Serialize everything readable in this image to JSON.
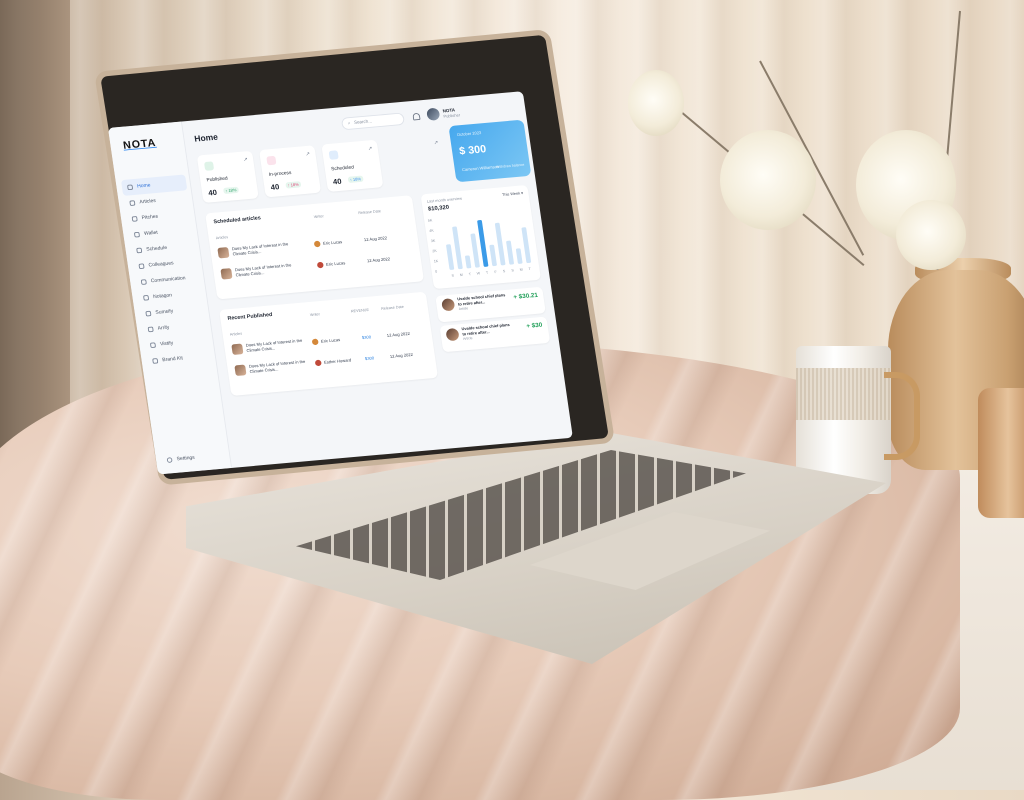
{
  "app": {
    "logo_text": "NOTA",
    "page_title": "Home"
  },
  "sidebar": {
    "items": [
      {
        "label": "Home",
        "icon": "home-icon",
        "active": true
      },
      {
        "label": "Articles",
        "icon": "articles-icon"
      },
      {
        "label": "Pitches",
        "icon": "pitches-icon"
      },
      {
        "label": "Wallet",
        "icon": "wallet-icon"
      },
      {
        "label": "Schedule",
        "icon": "schedule-icon"
      },
      {
        "label": "Colleagues",
        "icon": "colleagues-icon"
      },
      {
        "label": "Communication",
        "icon": "communication-icon"
      },
      {
        "label": "Notagon",
        "icon": "notagon-icon"
      },
      {
        "label": "Sumsify",
        "icon": "sumsify-icon"
      },
      {
        "label": "Arrify",
        "icon": "arrify-icon"
      },
      {
        "label": "Vistify",
        "icon": "vistify-icon"
      },
      {
        "label": "Brand Kit",
        "icon": "brand-kit-icon"
      }
    ],
    "settings_label": "Settings"
  },
  "header": {
    "search_placeholder": "Search...",
    "user_name": "NOTA",
    "user_role": "Publisher"
  },
  "stats": [
    {
      "label": "Published",
      "value": "40",
      "change": "↑ 18%",
      "color": "#2ea36a"
    },
    {
      "label": "In-process",
      "value": "40",
      "change": "↑ 18%",
      "color": "#e0487a"
    },
    {
      "label": "Scheduled",
      "value": "40",
      "change": "↑ 18%",
      "color": "#3b8ef0"
    }
  ],
  "balance": {
    "label": "October 2023",
    "amount": "$ 300",
    "name": "Cameron Williamson",
    "link": "Withdraw balance"
  },
  "scheduled_articles": {
    "title": "Scheduled articles",
    "col_articles": "Articles",
    "col_writer": "Writer",
    "col_release": "Release Date",
    "rows": [
      {
        "title": "Does My Lack of Interest in the Climate Crisis...",
        "writer": "Eric Lucas",
        "date": "12 Aug 2022"
      },
      {
        "title": "Does My Lack of Interest in the Climate Crisis...",
        "writer": "Eric Lucas",
        "date": "12 Aug 2022"
      }
    ]
  },
  "recent_published": {
    "title": "Recent Published",
    "col_articles": "Articles",
    "col_writer": "Writer",
    "col_revenue": "REVENUE",
    "col_release": "Release Date",
    "rows": [
      {
        "title": "Does My Lack of Interest in the Climate Crisis...",
        "writer": "Eric Lucas",
        "revenue": "$300",
        "date": "12 Aug 2022"
      },
      {
        "title": "Does My Lack of Interest in the Climate Crisis...",
        "writer": "Esther Howard",
        "revenue": "$300",
        "date": "12 Aug 2022"
      }
    ]
  },
  "overview": {
    "label": "Last month overview",
    "value": "$10,320",
    "filter": "This Week"
  },
  "chart_data": {
    "type": "bar",
    "categories": [
      "S",
      "M",
      "T",
      "W",
      "T",
      "F",
      "S",
      "S",
      "M",
      "T"
    ],
    "values": [
      30,
      50,
      15,
      40,
      55,
      25,
      50,
      28,
      18,
      42
    ],
    "highlight_index": 4,
    "y_ticks": [
      "5K",
      "4K",
      "3K",
      "2K",
      "1K",
      "0"
    ],
    "ylim": [
      0,
      60
    ],
    "colors": {
      "bar": "#cfe4f7",
      "highlight": "#3b9be8"
    }
  },
  "transactions": [
    {
      "title": "Uvalde school chief plans to retire after...",
      "sub": "Article",
      "amount": "+ $30.21"
    },
    {
      "title": "Uvalde school chief plans to retire after...",
      "sub": "Article",
      "amount": "+ $30"
    }
  ]
}
